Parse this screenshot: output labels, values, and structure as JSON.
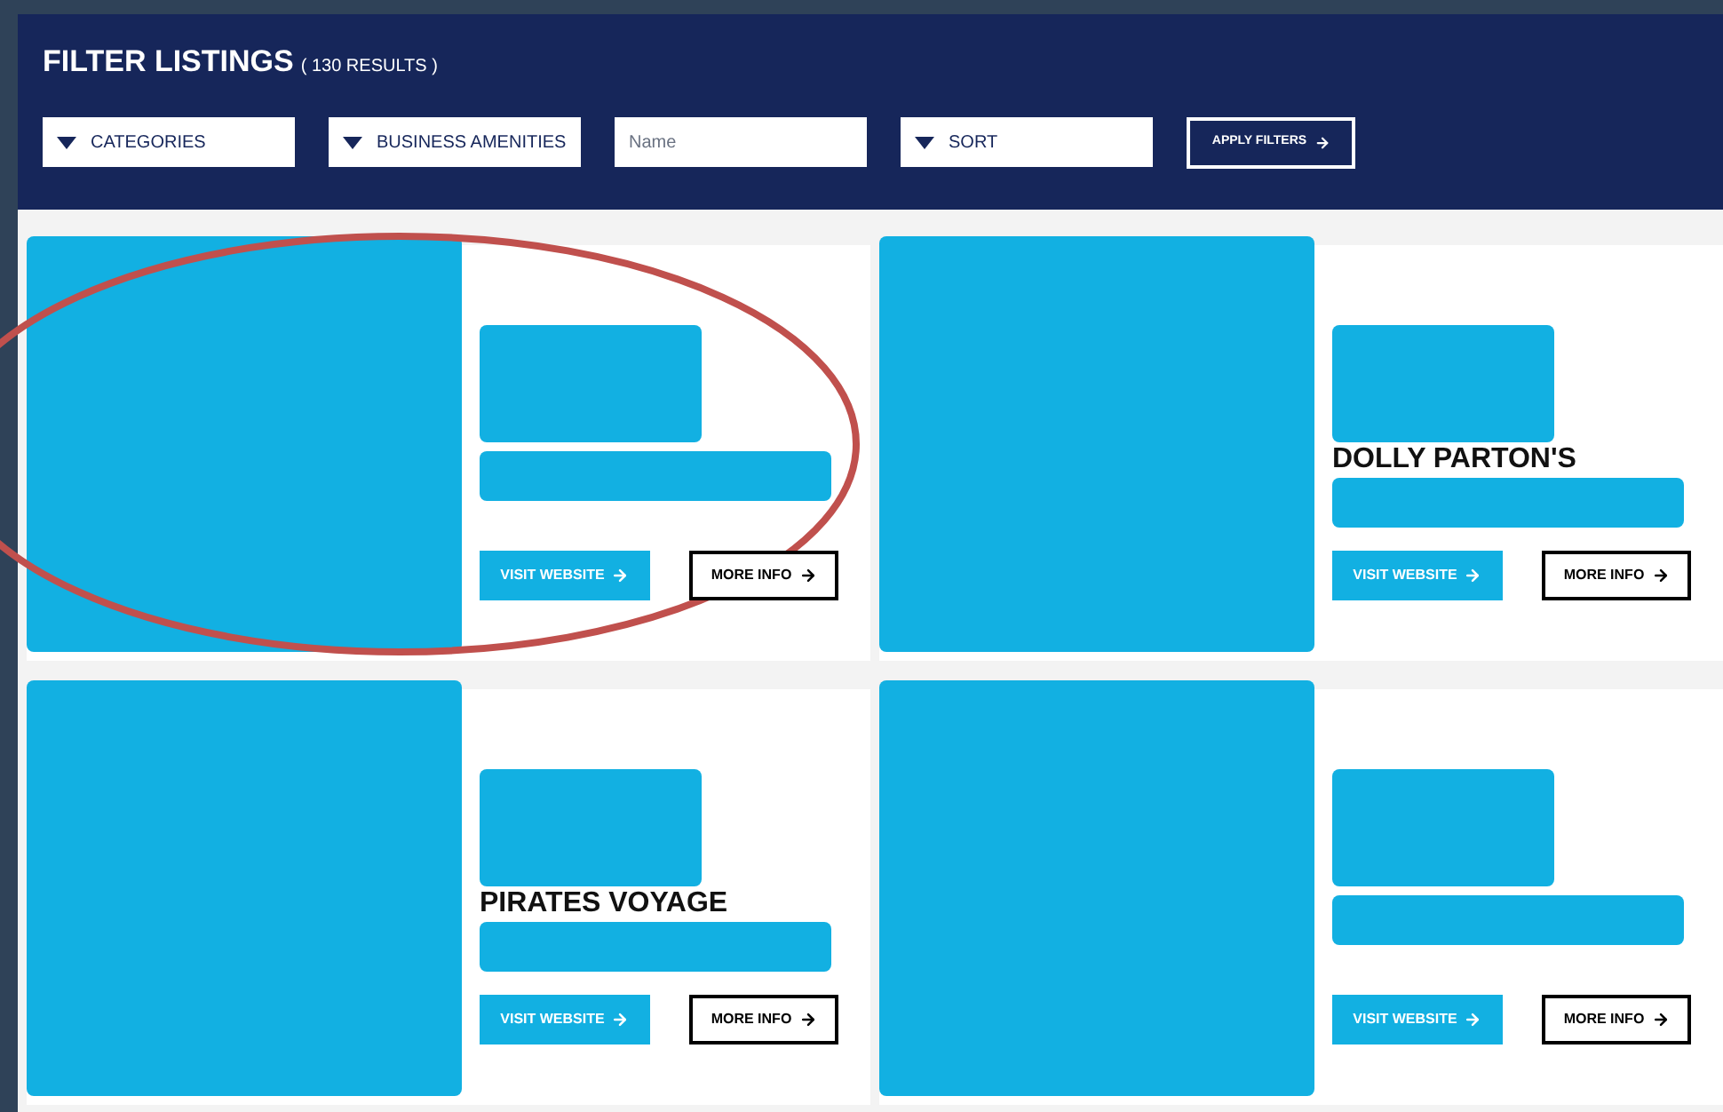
{
  "header": {
    "title": "FILTER LISTINGS",
    "count": "( 130 RESULTS )"
  },
  "filters": [
    {
      "kind": "dropdown",
      "label": "CATEGORIES"
    },
    {
      "kind": "dropdown",
      "label": "BUSINESS AMENITIES"
    },
    {
      "kind": "input",
      "placeholder": "Name"
    },
    {
      "kind": "dropdown",
      "label": "SORT"
    }
  ],
  "apply_button": "APPLY FILTERS",
  "listings": [
    {
      "visit_button": "VISIT WEBSITE",
      "info_button": "MORE INFO"
    },
    {
      "title": "DOLLY PARTON'S",
      "visit_button": "VISIT WEBSITE",
      "info_button": "MORE INFO"
    },
    {
      "title": "PIRATES VOYAGE",
      "visit_button": "VISIT WEBSITE",
      "info_button": "MORE INFO"
    },
    {
      "visit_button": "VISIT WEBSITE",
      "info_button": "MORE INFO"
    }
  ]
}
